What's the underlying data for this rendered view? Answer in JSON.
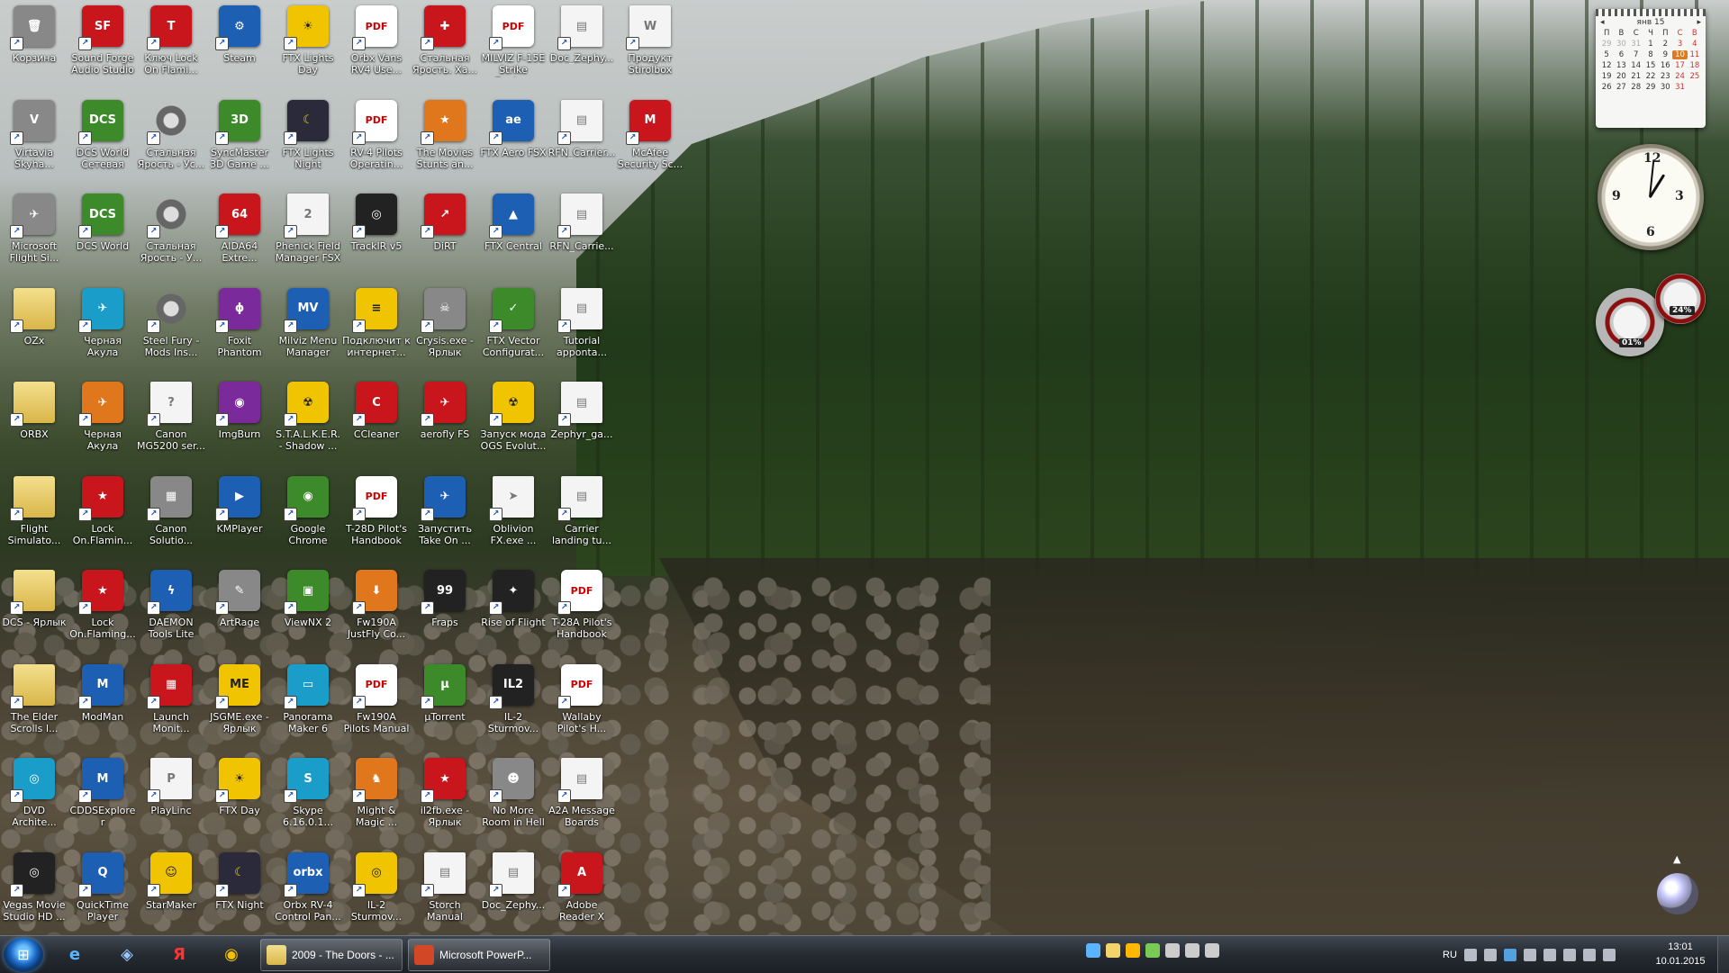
{
  "desktop": {
    "icons": [
      {
        "label": "Корзина",
        "icon": "recycle-bin-icon",
        "cls": "t-grey",
        "glyph": "🗑"
      },
      {
        "label": "Sound Forge Audio Studio",
        "icon": "sound-forge-icon",
        "cls": "t-red",
        "glyph": "SF"
      },
      {
        "label": "Ключ Lock On Flami...",
        "icon": "lock-on-key-icon",
        "cls": "t-red",
        "glyph": "T"
      },
      {
        "label": "Steam",
        "icon": "steam-icon",
        "cls": "t-blue",
        "glyph": "⚙"
      },
      {
        "label": "FTX Lights Day",
        "icon": "ftx-lights-day-icon",
        "cls": "t-yellow",
        "glyph": "☀"
      },
      {
        "label": "Orbx Vans RV4 Use...",
        "icon": "pdf-icon",
        "cls": "t-pdf",
        "glyph": "PDF"
      },
      {
        "label": "Стальная Ярость. Ха...",
        "icon": "steel-fury-icon",
        "cls": "t-red",
        "glyph": "✚"
      },
      {
        "label": "MILVIZ F-15E Strike Eagle...",
        "icon": "pdf-icon",
        "cls": "t-pdf",
        "glyph": "PDF"
      },
      {
        "label": "Doc_Zephy...",
        "icon": "document-icon",
        "cls": "t-doc",
        "glyph": "▤"
      },
      {
        "label": "Продукт Stirolbox",
        "icon": "document-icon",
        "cls": "t-doc",
        "glyph": "W"
      },
      {
        "label": "Virtavia Skyha...",
        "icon": "virtavia-icon",
        "cls": "t-grey",
        "glyph": "V"
      },
      {
        "label": "DCS World Сетевая игра",
        "icon": "dcs-icon",
        "cls": "t-green",
        "glyph": "DCS"
      },
      {
        "label": "Стальная Ярость - Ус...",
        "icon": "gear-icon",
        "cls": "t-gear",
        "glyph": ""
      },
      {
        "label": "SyncMaster 3D Game ...",
        "icon": "syncmaster-3d-icon",
        "cls": "t-green",
        "glyph": "3D"
      },
      {
        "label": "FTX Lights Night",
        "icon": "ftx-lights-night-icon",
        "cls": "t-orbx",
        "glyph": "☾"
      },
      {
        "label": "RV-4 Pilots Operatin...",
        "icon": "pdf-icon",
        "cls": "t-pdf",
        "glyph": "PDF"
      },
      {
        "label": "The Movies Stunts an...",
        "icon": "the-movies-icon",
        "cls": "t-orange",
        "glyph": "★"
      },
      {
        "label": "FTX Aero FSX",
        "icon": "ftx-aero-icon",
        "cls": "t-blue",
        "glyph": "ae"
      },
      {
        "label": "RFN_Carrier...",
        "icon": "document-icon",
        "cls": "t-doc",
        "glyph": "▤"
      },
      {
        "label": "McAfee Security Sc...",
        "icon": "mcafee-icon",
        "cls": "t-red",
        "glyph": "M"
      },
      {
        "label": "Microsoft Flight Si...",
        "icon": "flight-sim-icon",
        "cls": "t-grey",
        "glyph": "✈"
      },
      {
        "label": "DCS World",
        "icon": "dcs-icon",
        "cls": "t-green",
        "glyph": "DCS"
      },
      {
        "label": "Стальная Ярость - У...",
        "icon": "gear-icon",
        "cls": "t-gear",
        "glyph": ""
      },
      {
        "label": "AIDA64 Extre...",
        "icon": "aida64-icon",
        "cls": "t-red",
        "glyph": "64"
      },
      {
        "label": "Phenick Field Manager FSX",
        "icon": "field-manager-icon",
        "cls": "t-doc",
        "glyph": "2"
      },
      {
        "label": "TrackIR v5",
        "icon": "trackir-icon",
        "cls": "t-dark",
        "glyph": "◎"
      },
      {
        "label": "DiRT",
        "icon": "dirt-icon",
        "cls": "t-red",
        "glyph": "↗"
      },
      {
        "label": "FTX Central",
        "icon": "ftx-central-icon",
        "cls": "t-blue",
        "glyph": "▲"
      },
      {
        "label": "RFN_Carrie...",
        "icon": "document-icon",
        "cls": "t-doc",
        "glyph": "▤"
      },
      {
        "label": "OZx",
        "icon": "folder-icon",
        "cls": "t-folder",
        "glyph": ""
      },
      {
        "label": "Черная Акула",
        "icon": "black-shark-icon",
        "cls": "t-cyan",
        "glyph": "✈"
      },
      {
        "label": "Steel Fury - Mods Ins...",
        "icon": "gear-icon",
        "cls": "t-gear",
        "glyph": ""
      },
      {
        "label": "Foxit Phantom",
        "icon": "foxit-icon",
        "cls": "t-purple",
        "glyph": "ϕ"
      },
      {
        "label": "Milviz Menu Manager",
        "icon": "milviz-icon",
        "cls": "t-blue",
        "glyph": "MV"
      },
      {
        "label": "Подключит к интернет...",
        "icon": "beeline-icon",
        "cls": "t-yellow",
        "glyph": "≡"
      },
      {
        "label": "Crysis.exe - Ярлык",
        "icon": "crysis-icon",
        "cls": "t-grey",
        "glyph": "☠"
      },
      {
        "label": "FTX Vector Configurat...",
        "icon": "ftx-vector-icon",
        "cls": "t-green",
        "glyph": "✓"
      },
      {
        "label": "Tutorial appontа...",
        "icon": "document-icon",
        "cls": "t-doc",
        "glyph": "▤"
      },
      {
        "label": "ORBX",
        "icon": "folder-icon",
        "cls": "t-folder",
        "glyph": ""
      },
      {
        "label": "Черная Акула",
        "icon": "black-shark-icon",
        "cls": "t-orange",
        "glyph": "✈"
      },
      {
        "label": "Canon MG5200 ser...",
        "icon": "help-document-icon",
        "cls": "t-doc",
        "glyph": "?"
      },
      {
        "label": "ImgBurn",
        "icon": "imgburn-icon",
        "cls": "t-purple",
        "glyph": "◉"
      },
      {
        "label": "S.T.A.L.K.E.R. - Shadow ...",
        "icon": "radiation-icon",
        "cls": "t-yellow",
        "glyph": "☢"
      },
      {
        "label": "CCleaner",
        "icon": "ccleaner-icon",
        "cls": "t-red",
        "glyph": "C"
      },
      {
        "label": "aerofly FS",
        "icon": "aerofly-icon",
        "cls": "t-red",
        "glyph": "✈"
      },
      {
        "label": "Запуск мода OGS Evolut...",
        "icon": "radiation-icon",
        "cls": "t-yellow",
        "glyph": "☢"
      },
      {
        "label": "Zephyr_ga...",
        "icon": "document-icon",
        "cls": "t-doc",
        "glyph": "▤"
      },
      {
        "label": "Flight Simulato...",
        "icon": "folder-icon",
        "cls": "t-folder",
        "glyph": ""
      },
      {
        "label": "Lock On.Flamin...",
        "icon": "lock-on-icon",
        "cls": "t-red",
        "glyph": "★"
      },
      {
        "label": "Canon Solutio...",
        "icon": "canon-icon",
        "cls": "t-grey",
        "glyph": "▦"
      },
      {
        "label": "KMPlayer",
        "icon": "kmplayer-icon",
        "cls": "t-blue",
        "glyph": "▶"
      },
      {
        "label": "Google Chrome",
        "icon": "chrome-icon",
        "cls": "t-green",
        "glyph": "◉"
      },
      {
        "label": "T-28D Pilot's Handbook",
        "icon": "pdf-icon",
        "cls": "t-pdf",
        "glyph": "PDF"
      },
      {
        "label": "Запустить Take On ...",
        "icon": "take-on-icon",
        "cls": "t-blue",
        "glyph": "✈"
      },
      {
        "label": "Oblivion FX.exe ...",
        "icon": "oblivion-icon",
        "cls": "t-doc",
        "glyph": "➤"
      },
      {
        "label": "Carrier landing tu...",
        "icon": "document-icon",
        "cls": "t-doc",
        "glyph": "▤"
      },
      {
        "label": "DCS - Ярлык",
        "icon": "folder-icon",
        "cls": "t-folder",
        "glyph": ""
      },
      {
        "label": "Lock On.Flaming...",
        "icon": "lock-on-icon",
        "cls": "t-red",
        "glyph": "★"
      },
      {
        "label": "DAEMON Tools Lite",
        "icon": "daemon-tools-icon",
        "cls": "t-blue",
        "glyph": "ϟ"
      },
      {
        "label": "ArtRage",
        "icon": "artrage-icon",
        "cls": "t-grey",
        "glyph": "✎"
      },
      {
        "label": "ViewNX 2",
        "icon": "viewnx-icon",
        "cls": "t-green",
        "glyph": "▣"
      },
      {
        "label": "Fw190A JustFly Co...",
        "icon": "installer-icon",
        "cls": "t-orange",
        "glyph": "⬇"
      },
      {
        "label": "Fraps",
        "icon": "fraps-icon",
        "cls": "t-dark",
        "glyph": "99"
      },
      {
        "label": "Rise of Flight",
        "icon": "rise-of-flight-icon",
        "cls": "t-dark",
        "glyph": "✦"
      },
      {
        "label": "T-28A Pilot's Handbook",
        "icon": "pdf-icon",
        "cls": "t-pdf",
        "glyph": "PDF"
      },
      {
        "label": "The Elder Scrolls I...",
        "icon": "folder-icon",
        "cls": "t-folder",
        "glyph": ""
      },
      {
        "label": "ModMan",
        "icon": "modman-icon",
        "cls": "t-blue",
        "glyph": "M"
      },
      {
        "label": "Launch Monit...",
        "icon": "launch-monitor-icon",
        "cls": "t-red",
        "glyph": "▦"
      },
      {
        "label": "JSGME.exe - Ярлык",
        "icon": "jsgme-icon",
        "cls": "t-yellow",
        "glyph": "ME"
      },
      {
        "label": "Panorama Maker 6",
        "icon": "panorama-icon",
        "cls": "t-cyan",
        "glyph": "▭"
      },
      {
        "label": "Fw190A Pilots Manual",
        "icon": "pdf-icon",
        "cls": "t-pdf",
        "glyph": "PDF"
      },
      {
        "label": "µTorrent",
        "icon": "utorrent-icon",
        "cls": "t-green",
        "glyph": "µ"
      },
      {
        "label": "IL-2 Sturmov...",
        "icon": "il2-icon",
        "cls": "t-dark",
        "glyph": "IL2"
      },
      {
        "label": "Wallaby Pilot's H...",
        "icon": "pdf-icon",
        "cls": "t-pdf",
        "glyph": "PDF"
      },
      {
        "label": "DVD Archite...",
        "icon": "dvd-architect-icon",
        "cls": "t-cyan",
        "glyph": "◎"
      },
      {
        "label": "CDDSExplorer",
        "icon": "cddsexplorer-icon",
        "cls": "t-blue",
        "glyph": "M"
      },
      {
        "label": "PlayLinc",
        "icon": "playlinc-icon",
        "cls": "t-doc",
        "glyph": "P"
      },
      {
        "label": "FTX Day",
        "icon": "ftx-day-icon",
        "cls": "t-yellow",
        "glyph": "☀"
      },
      {
        "label": "Skype 6.16.0.1...",
        "icon": "skype-icon",
        "cls": "t-cyan",
        "glyph": "S"
      },
      {
        "label": "Might & Magic ...",
        "icon": "might-magic-icon",
        "cls": "t-orange",
        "glyph": "♞"
      },
      {
        "label": "il2fb.exe - Ярлык",
        "icon": "il2fb-icon",
        "cls": "t-red",
        "glyph": "★"
      },
      {
        "label": "No More Room in Hell",
        "icon": "nmrih-icon",
        "cls": "t-grey",
        "glyph": "☻"
      },
      {
        "label": "A2A Message Boards",
        "icon": "document-icon",
        "cls": "t-doc",
        "glyph": "▤"
      },
      {
        "label": "Vegas Movie Studio HD ...",
        "icon": "vegas-icon",
        "cls": "t-dark",
        "glyph": "◎"
      },
      {
        "label": "QuickTime Player",
        "icon": "quicktime-icon",
        "cls": "t-blue",
        "glyph": "Q"
      },
      {
        "label": "StarMaker",
        "icon": "starmaker-icon",
        "cls": "t-yellow",
        "glyph": "☺"
      },
      {
        "label": "FTX Night",
        "icon": "ftx-night-icon",
        "cls": "t-orbx",
        "glyph": "☾"
      },
      {
        "label": "Orbx RV-4 Control Pan...",
        "icon": "orbx-icon",
        "cls": "t-blue",
        "glyph": "orbx"
      },
      {
        "label": "IL-2 Sturmov...",
        "icon": "il2-sturmovik-icon",
        "cls": "t-yellow",
        "glyph": "◎"
      },
      {
        "label": "Storch Manual",
        "icon": "document-icon",
        "cls": "t-doc",
        "glyph": "▤"
      },
      {
        "label": "Doc_Zephy...",
        "icon": "document-icon",
        "cls": "t-doc",
        "glyph": "▤"
      },
      {
        "label": "Adobe Reader X",
        "icon": "adobe-reader-icon",
        "cls": "t-red",
        "glyph": "A"
      }
    ]
  },
  "calendar": {
    "month": "янв 15",
    "days_header": [
      "П",
      "В",
      "С",
      "Ч",
      "П",
      "С",
      "В"
    ],
    "cells": [
      "29",
      "30",
      "31",
      "1",
      "2",
      "3",
      "4",
      "5",
      "6",
      "7",
      "8",
      "9",
      "10",
      "11",
      "12",
      "13",
      "14",
      "15",
      "16",
      "17",
      "18",
      "19",
      "20",
      "21",
      "22",
      "23",
      "24",
      "25",
      "26",
      "27",
      "28",
      "29",
      "30",
      "31",
      ""
    ],
    "today": "10"
  },
  "meters": {
    "cpu": "01%",
    "ram": "24%"
  },
  "taskbar": {
    "tasks": [
      {
        "label": "2009 - The Doors - ...",
        "icon": "folder-icon"
      },
      {
        "label": "Microsoft PowerP...",
        "icon": "powerpoint-icon"
      }
    ],
    "lang": "RU",
    "time": "13:01",
    "date": "10.01.2015"
  },
  "colors": {
    "taskbar": "#262b32",
    "today": "#e07b1d"
  }
}
